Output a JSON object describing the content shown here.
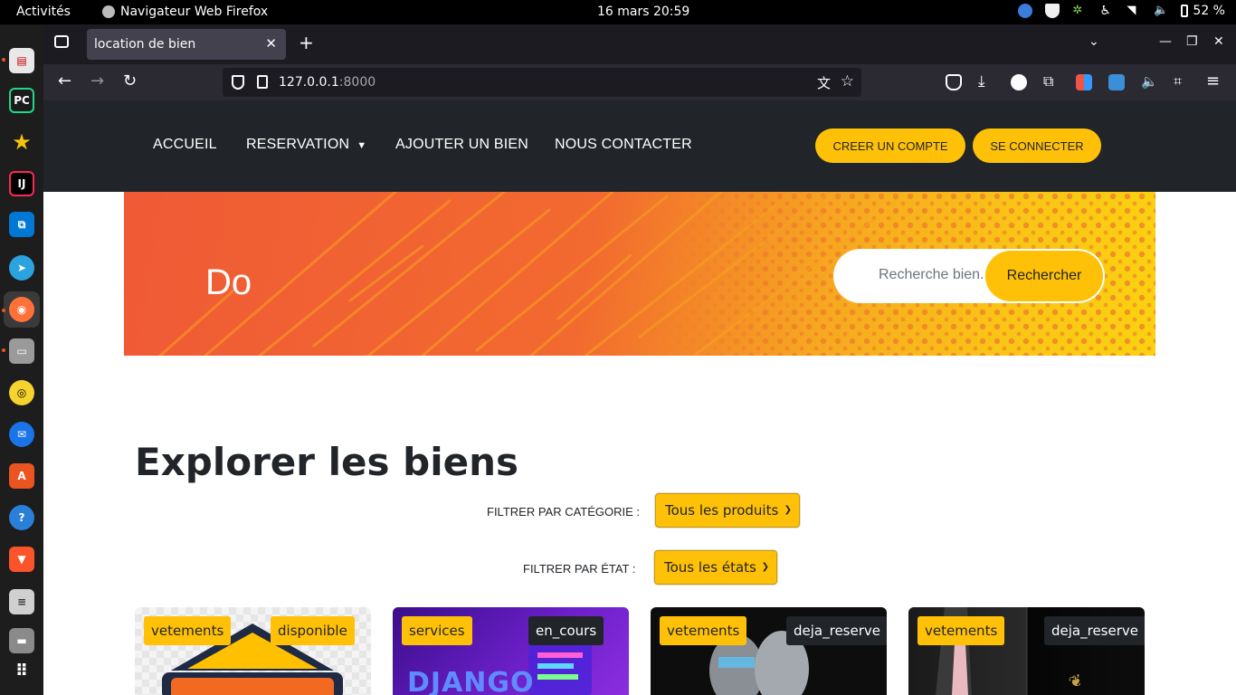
{
  "system": {
    "activities": "Activités",
    "app_name": "Navigateur Web Firefox",
    "clock": "16 mars  20:59",
    "battery": "52 %"
  },
  "browser": {
    "tab_title": "location de bien",
    "url_host": "127.0.0.1",
    "url_port": ":8000"
  },
  "nav": {
    "items": [
      "ACCUEIL",
      "RESERVATION",
      "AJOUTER UN BIEN",
      "NOUS CONTACTER"
    ],
    "register": "CREER UN COMPTE",
    "login": "SE CONNECTER"
  },
  "hero": {
    "text": "Do",
    "search_placeholder": "Recherche bien...",
    "search_button": "Rechercher",
    "colors": {
      "left": "#f05a36",
      "right": "#fad210"
    }
  },
  "catalog": {
    "title": "Explorer les biens",
    "filter_category_label": "FILTRER PAR CATÉGORIE :",
    "filter_category_value": "Tous les produits",
    "filter_state_label": "FILTRER PAR ÉTAT :",
    "filter_state_value": "Tous les états",
    "cards": [
      {
        "category": "vetements",
        "state": "disponible"
      },
      {
        "category": "services",
        "state": "en_cours",
        "image_text": "DJANGO"
      },
      {
        "category": "vetements",
        "state": "deja_reserve"
      },
      {
        "category": "vetements",
        "state": "deja_reserve"
      }
    ]
  },
  "colors": {
    "accent": "#ffc107",
    "header_bg": "#212529"
  }
}
